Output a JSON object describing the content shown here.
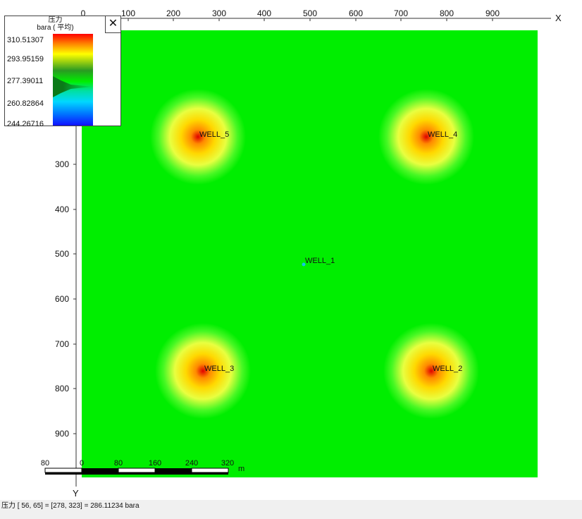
{
  "plot": {
    "x_axis_label": "X",
    "y_axis_label": "Y",
    "x_ticks": [
      "0",
      "100",
      "200",
      "300",
      "400",
      "500",
      "600",
      "700",
      "800",
      "900"
    ],
    "y_ticks": [
      "300",
      "400",
      "500",
      "600",
      "700",
      "800",
      "900"
    ],
    "background_color": "#00ee00",
    "wells": [
      {
        "name": "WELL_5",
        "type": "injector"
      },
      {
        "name": "WELL_4",
        "type": "injector"
      },
      {
        "name": "WELL_1",
        "type": "producer"
      },
      {
        "name": "WELL_3",
        "type": "injector"
      },
      {
        "name": "WELL_2",
        "type": "injector"
      }
    ]
  },
  "legend": {
    "title": "压力",
    "subtitle": "bara ( 平均)",
    "close_label": "✕",
    "values": [
      "310.51307",
      "293.95159",
      "277.39011",
      "260.82864",
      "244.26716"
    ]
  },
  "scalebar": {
    "labels": [
      "80",
      "0",
      "80",
      "160",
      "240",
      "320"
    ],
    "unit": "m"
  },
  "status_bar": {
    "text": "压力 [ 56,  65] = [278, 323] = 286.11234  bara"
  }
}
